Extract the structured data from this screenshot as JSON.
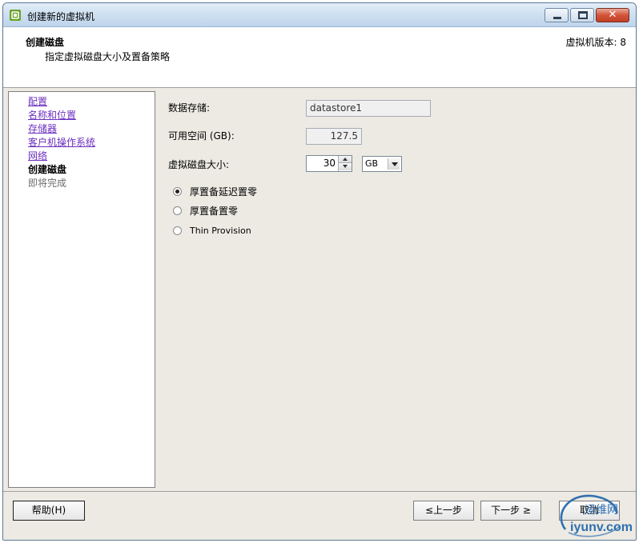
{
  "window": {
    "title": "创建新的虚拟机"
  },
  "header": {
    "title": "创建磁盘",
    "subtitle": "指定虚拟磁盘大小及置备策略",
    "version": "虚拟机版本: 8"
  },
  "nav": {
    "items": [
      {
        "label": "配置",
        "state": "link"
      },
      {
        "label": "名称和位置",
        "state": "link"
      },
      {
        "label": "存储器",
        "state": "link"
      },
      {
        "label": "客户机操作系统",
        "state": "link"
      },
      {
        "label": "网络",
        "state": "link"
      },
      {
        "label": "创建磁盘",
        "state": "current"
      },
      {
        "label": "即将完成",
        "state": "pending"
      }
    ]
  },
  "form": {
    "datastore_label": "数据存储:",
    "datastore_value": "datastore1",
    "free_space_label": "可用空间 (GB):",
    "free_space_value": "127.5",
    "disk_size_label": "虚拟磁盘大小:",
    "disk_size_value": "30",
    "disk_unit": "GB",
    "provisioning": [
      {
        "label": "厚置备延迟置零",
        "selected": true
      },
      {
        "label": "厚置备置零",
        "selected": false
      },
      {
        "label": "Thin Provision",
        "selected": false
      }
    ]
  },
  "footer": {
    "help_label": "帮助(H)",
    "back_label": "≤上一步",
    "next_label": "下一步 ≥",
    "cancel_label": "取消"
  },
  "watermark": {
    "line1": "运维网",
    "line2": "iyunv.com"
  },
  "colors": {
    "link": "#6b2fbf",
    "titlebar": "#cfe0f1",
    "close_button": "#c8452b",
    "dialog_bg": "#eceae3"
  }
}
